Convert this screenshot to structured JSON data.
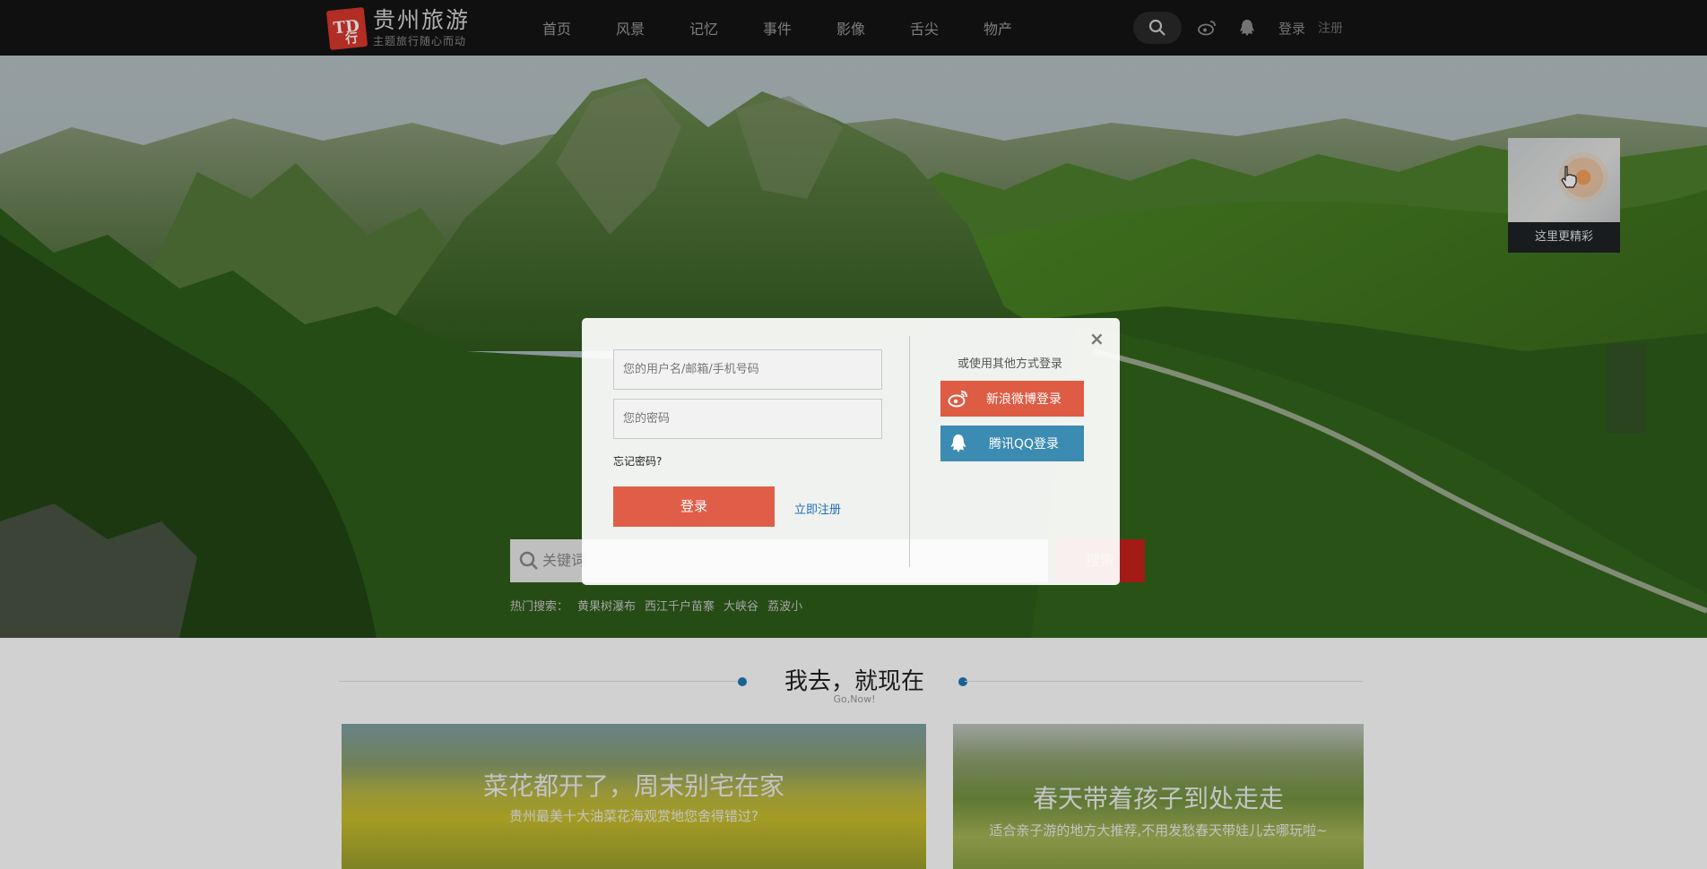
{
  "header": {
    "logo_mark": "TD行",
    "logo_title": "贵州旅游",
    "logo_subtitle": "主题旅行随心而动",
    "nav": [
      "首页",
      "风景",
      "记忆",
      "事件",
      "影像",
      "舌尖",
      "物产"
    ],
    "login_label": "登录",
    "register_label": "注册"
  },
  "hero": {
    "map_caption": "这里更精彩",
    "search_placeholder": "关键词",
    "search_button": "搜索",
    "hot_search_label": "热门搜索：",
    "hot_terms": [
      "黄果树瀑布",
      "西江千户苗寨",
      "大峡谷",
      "荔波小"
    ],
    "slide_count": 3,
    "active_slide": 2
  },
  "section": {
    "title": "我去，就现在",
    "subtitle": "Go,Now!"
  },
  "cards": [
    {
      "title": "菜花都开了，周末别宅在家",
      "subtitle": "贵州最美十大油菜花海观赏地您舍得错过?"
    },
    {
      "title": "春天带着孩子到处走走",
      "subtitle": "适合亲子游的地方大推荐,不用发愁春天带娃儿去哪玩啦~"
    }
  ],
  "login_modal": {
    "close_symbol": "×",
    "username_placeholder": "您的用户名/邮箱/手机号码",
    "password_placeholder": "您的密码",
    "forgot_label": "忘记密码?",
    "login_button": "登录",
    "register_link": "立即注册",
    "other_title": "或使用其他方式登录",
    "weibo_button": "新浪微博登录",
    "qq_button": "腾讯QQ登录"
  },
  "colors": {
    "topbar": "#141414",
    "brand_red": "#d9382c",
    "login_button": "#e05d47",
    "weibo": "#de5b44",
    "qq": "#3c8bb2",
    "link_blue": "#1f6dbd",
    "section_bullet": "#1f78b7"
  },
  "icons": {
    "search": "search-icon",
    "weibo": "weibo-icon",
    "qq": "qq-icon",
    "close": "close-icon",
    "hand_cursor": "hand-pointer-icon"
  }
}
